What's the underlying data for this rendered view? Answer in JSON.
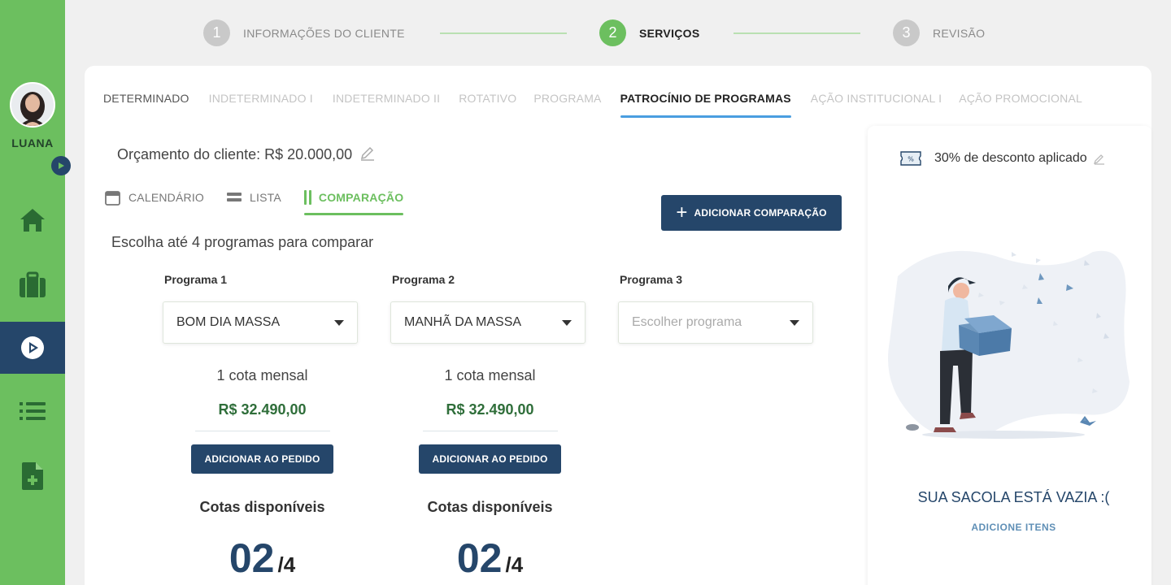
{
  "user": {
    "name": "LUANA"
  },
  "stepper": {
    "steps": [
      {
        "number": "1",
        "label": "INFORMAÇÕES DO CLIENTE"
      },
      {
        "number": "2",
        "label": "SERVIÇOS"
      },
      {
        "number": "3",
        "label": "REVISÃO"
      }
    ],
    "active_step": "2"
  },
  "service_tabs": [
    "DETERMINADO",
    "INDETERMINADO I",
    "INDETERMINADO II",
    "ROTATIVO",
    "PROGRAMA",
    "PATROCÍNIO DE PROGRAMAS",
    "AÇÃO INSTITUCIONAL I",
    "AÇÃO PROMOCIONAL"
  ],
  "active_service_tab": "PATROCÍNIO DE PROGRAMAS",
  "budget": {
    "label": "Orçamento do cliente: R$ 20.000,00"
  },
  "view_tabs": [
    "CALENDÁRIO",
    "LISTA",
    "COMPARAÇÃO"
  ],
  "active_view_tab": "COMPARAÇÃO",
  "add_comparison_label": "ADICIONAR COMPARAÇÃO",
  "instruction": "Escolha até 4 programas para comparar",
  "programs": [
    {
      "title": "Programa 1",
      "selected": "BOM DIA MASSA",
      "quota_label": "1 cota mensal",
      "price": "R$ 32.490,00",
      "add_label": "ADICIONAR AO PEDIDO",
      "available_label": "Cotas disponíveis",
      "available": "02",
      "total": "/4"
    },
    {
      "title": "Programa 2",
      "selected": "MANHÃ DA MASSA",
      "quota_label": "1 cota mensal",
      "price": "R$ 32.490,00",
      "add_label": "ADICIONAR AO PEDIDO",
      "available_label": "Cotas disponíveis",
      "available": "02",
      "total": "/4"
    },
    {
      "title": "Programa 3",
      "placeholder": "Escolher programa"
    }
  ],
  "cart": {
    "discount_label": "30% de desconto aplicado",
    "empty_title": "SUA SACOLA ESTÁ VAZIA :(",
    "empty_link": "ADICIONE ITENS"
  },
  "colors": {
    "brand_green": "#6cbf5f",
    "navy": "#25466a",
    "price_green": "#2f6e3a",
    "tab_blue": "#4a9ee0"
  },
  "icons": {
    "nav": [
      "home-icon",
      "briefcase-icon",
      "play-circle-icon",
      "list-icon",
      "add-file-icon"
    ]
  }
}
